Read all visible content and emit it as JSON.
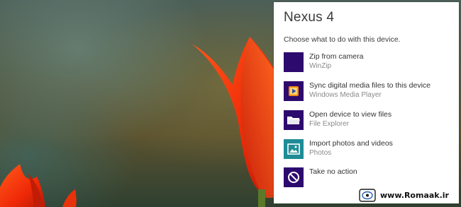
{
  "panel": {
    "title": "Nexus 4",
    "subtitle": "Choose what to do with this device."
  },
  "options": [
    {
      "label": "Zip from camera",
      "sub": "WinZip",
      "icon": "winzip-icon"
    },
    {
      "label": "Sync digital media files to this device",
      "sub": "Windows Media Player",
      "icon": "windows-media-player-icon"
    },
    {
      "label": "Open device to view files",
      "sub": "File Explorer",
      "icon": "folder-icon"
    },
    {
      "label": "Import photos and videos",
      "sub": "Photos",
      "icon": "photos-icon"
    },
    {
      "label": "Take no action",
      "sub": "",
      "icon": "no-action-icon"
    }
  ],
  "watermark": {
    "text": "www.Romaak.ir",
    "logo": "romaak-logo-icon"
  },
  "colors": {
    "tile_purple": "#2d0a6e",
    "photos_teal": "#1e8c96",
    "panel_bg": "#ffffff",
    "flower_red": "#ff3a0a"
  }
}
